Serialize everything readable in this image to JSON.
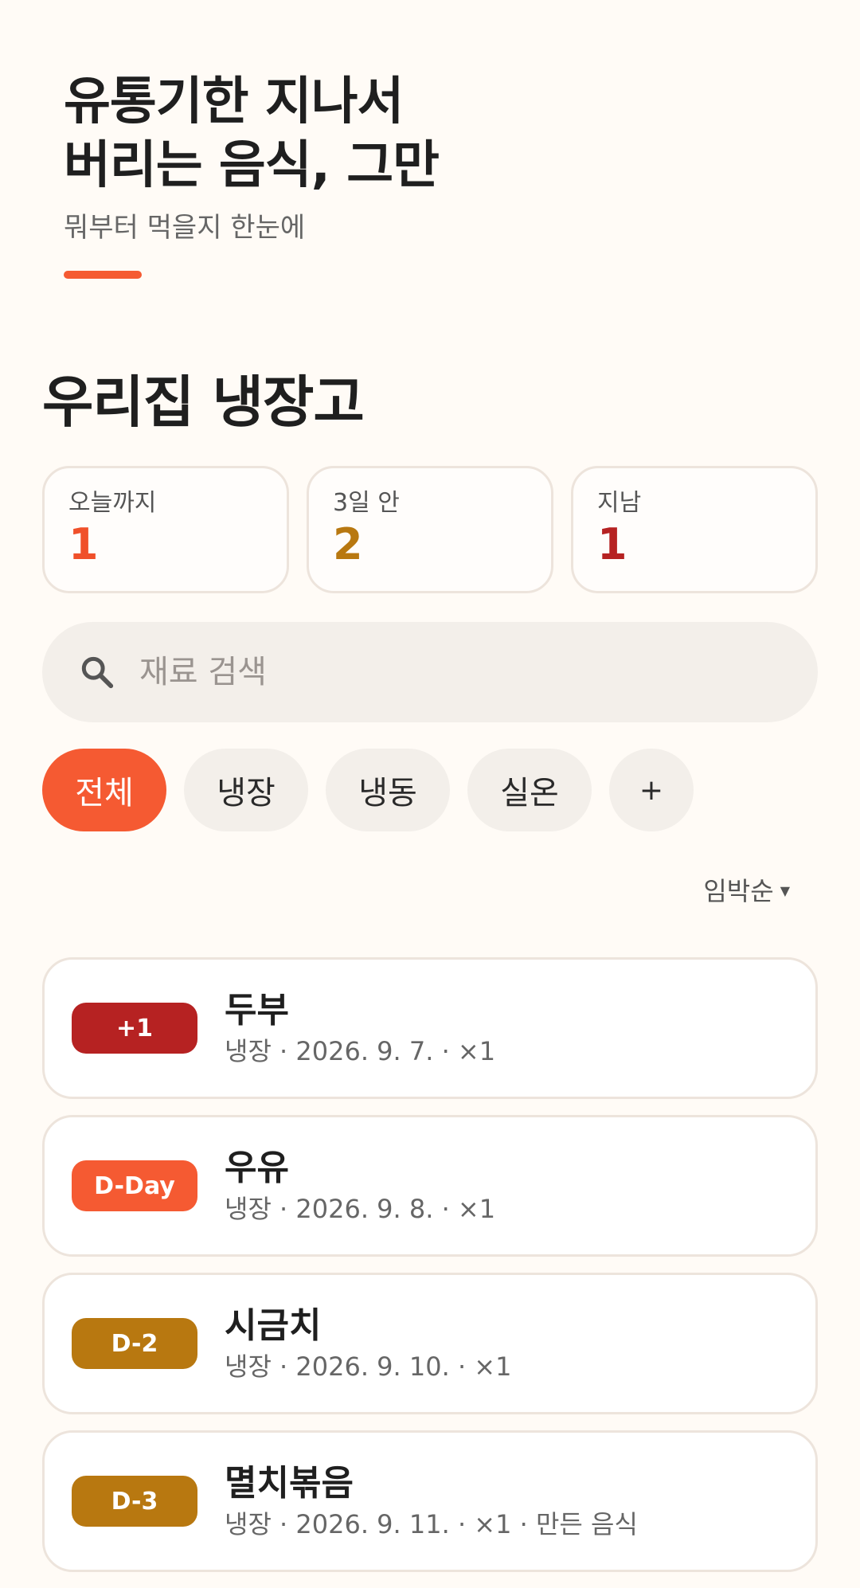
{
  "hero": {
    "title_line1": "유통기한 지나서",
    "title_line2": "버리는 음식, 그만",
    "subtitle": "뭐부터 먹을지 한눈에",
    "accent_color": "#f55a32"
  },
  "section_title": "우리집 냉장고",
  "stats": [
    {
      "label": "오늘까지",
      "value": "1",
      "color": "#f0502a"
    },
    {
      "label": "3일 안",
      "value": "2",
      "color": "#b87810"
    },
    {
      "label": "지남",
      "value": "1",
      "color": "#b62222"
    }
  ],
  "search": {
    "icon": "search-icon",
    "placeholder": "재료 검색"
  },
  "filters": [
    {
      "label": "전체",
      "active": true
    },
    {
      "label": "냉장",
      "active": false
    },
    {
      "label": "냉동",
      "active": false
    },
    {
      "label": "실온",
      "active": false
    },
    {
      "label": "+",
      "active": false
    }
  ],
  "sort": {
    "label": "임박순",
    "caret": "▼"
  },
  "items": [
    {
      "badge": "+1",
      "badge_color": "#b62222",
      "name": "두부",
      "meta": "냉장 · 2026. 9. 7. · ×1"
    },
    {
      "badge": "D-Day",
      "badge_color": "#f55a32",
      "name": "우유",
      "meta": "냉장 · 2026. 9. 8. · ×1"
    },
    {
      "badge": "D-2",
      "badge_color": "#b87810",
      "name": "시금치",
      "meta": "냉장 · 2026. 9. 10. · ×1"
    },
    {
      "badge": "D-3",
      "badge_color": "#b87810",
      "name": "멸치볶음",
      "meta": "냉장 · 2026. 9. 11. · ×1 · 만든 음식"
    }
  ]
}
